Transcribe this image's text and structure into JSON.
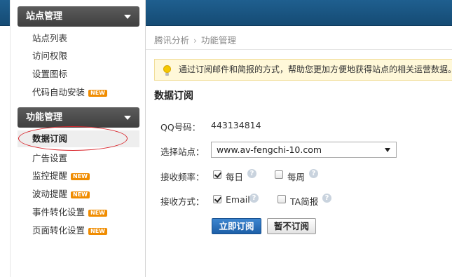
{
  "sidebar": {
    "group1": {
      "title": "站点管理",
      "items": [
        {
          "label": "站点列表"
        },
        {
          "label": "访问权限"
        },
        {
          "label": "设置图标"
        },
        {
          "label": "代码自动安装",
          "badge": "NEW"
        }
      ]
    },
    "group2": {
      "title": "功能管理",
      "items": [
        {
          "label": "数据订阅",
          "active": true
        },
        {
          "label": "广告设置"
        },
        {
          "label": "监控提醒",
          "badge": "NEW"
        },
        {
          "label": "波动提醒",
          "badge": "NEW"
        },
        {
          "label": "事件转化设置",
          "badge": "NEW"
        },
        {
          "label": "页面转化设置",
          "badge": "NEW"
        }
      ]
    }
  },
  "breadcrumb": {
    "root": "腾讯分析",
    "separator": "›",
    "current": "功能管理"
  },
  "notice": {
    "text": "通过订阅邮件和简报的方式，帮助您更加方便地获得站点的相关运营数据。"
  },
  "form": {
    "title": "数据订阅",
    "qq_label": "QQ号码：",
    "qq_value": "443134814",
    "site_label": "选择站点：",
    "site_value": "www.av-fengchi-10.com",
    "frequency_label": "接收频率：",
    "frequency_options": [
      {
        "label": "每日",
        "checked": true
      },
      {
        "label": "每周",
        "checked": false
      }
    ],
    "method_label": "接收方式：",
    "method_options": [
      {
        "label": "Email",
        "checked": true
      },
      {
        "label": "TA简报",
        "checked": false
      }
    ],
    "help_glyph": "?",
    "subscribe_button": "立即订阅",
    "cancel_button": "暂不订阅"
  },
  "colors": {
    "topbar": "#1a5787",
    "primary_button": "#2a6fbc",
    "badge": "#f08c00",
    "annotation": "#d9252b"
  }
}
